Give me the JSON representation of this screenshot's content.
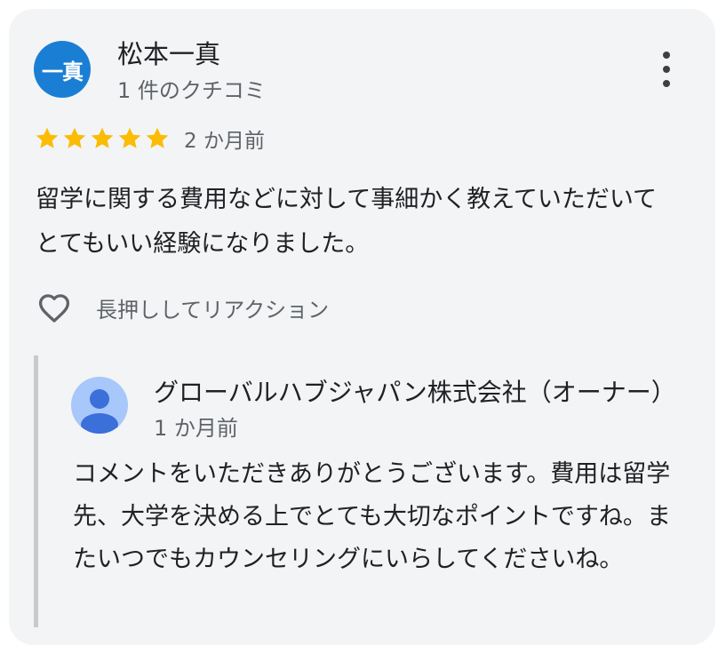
{
  "review": {
    "avatar_initials": "一真",
    "avatar_color": "#1a7fd4",
    "author_name": "松本一真",
    "review_count": "1 件のクチコミ",
    "rating": 5,
    "rating_max": 5,
    "star_color": "#fbbc04",
    "date": "2 か月前",
    "text": "留学に関する費用などに対して事細かく教えていただいてとてもいい経験になりました。",
    "reaction_label": "長押ししてリアクション",
    "menu_icon": "more-vert-icon",
    "reaction_icon": "heart-outline-icon"
  },
  "owner_reply": {
    "name": "グローバルハブジャパン株式会社（オーナー）",
    "date": "1 か月前",
    "text": "コメントをいただきありがとうございます。費用は留学先、大学を決める上でとても大切なポイントですね。またいつでもカウンセリングにいらしてくださいね。",
    "avatar_icon": "default-person-icon",
    "avatar_bg": "#a8c7fa",
    "avatar_fg": "#3b6fd9"
  }
}
